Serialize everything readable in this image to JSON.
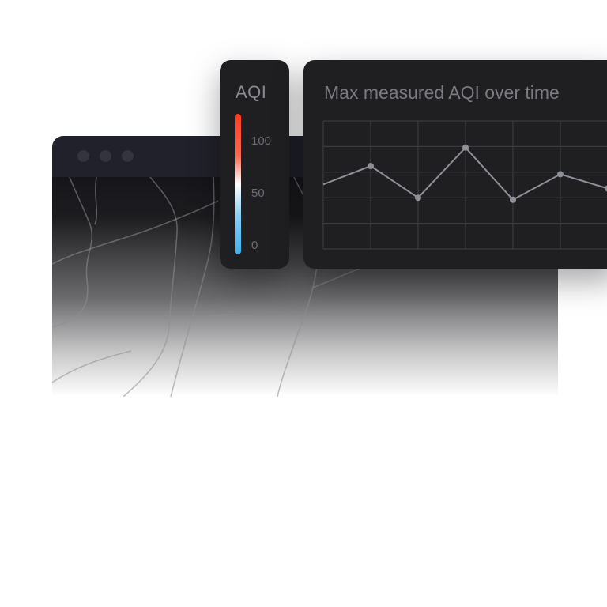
{
  "legend": {
    "title": "AQI",
    "ticks": [
      "100",
      "50",
      "0"
    ],
    "gradient_colors": [
      "#ff3b20",
      "#ffffff",
      "#3fb0ec"
    ]
  },
  "chart_data": {
    "type": "line",
    "title": "Max measured AQI over time",
    "ylim": [
      0,
      125
    ],
    "grid": true,
    "series": [
      {
        "values": [
          63,
          81,
          50,
          99,
          48,
          73,
          59
        ]
      }
    ],
    "colors": {
      "line": "#8f8f97",
      "grid": "#3a3a40"
    }
  },
  "browser": {
    "colors": {
      "titlebar": "#20212a",
      "dot": "#33343c"
    }
  }
}
